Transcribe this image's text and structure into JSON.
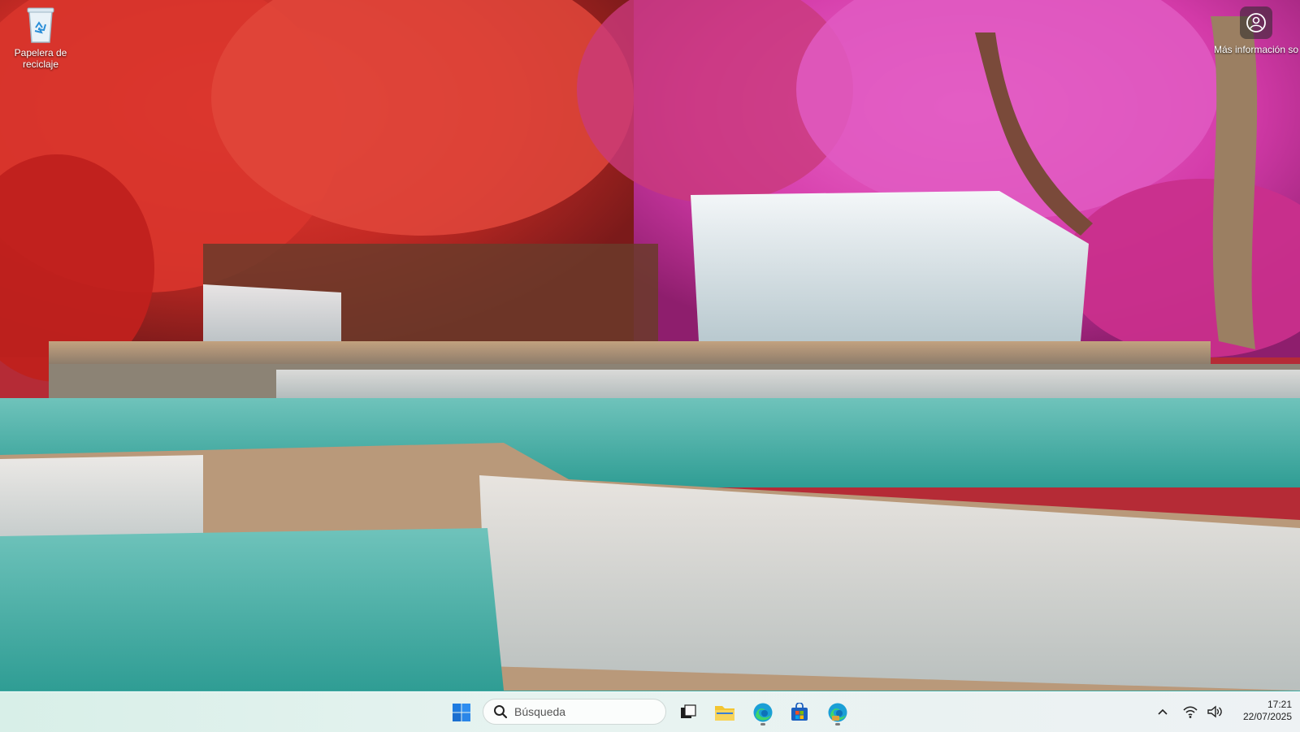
{
  "desktop": {
    "icons": [
      {
        "name": "recycle-bin",
        "label": "Papelera de reciclaje"
      },
      {
        "name": "more-info",
        "label": "Más información sobre esta imagen"
      }
    ]
  },
  "taskbar": {
    "search_placeholder": "Búsqueda",
    "pinned": [
      "Inicio",
      "Vista de tareas",
      "Explorador de archivos",
      "Microsoft Edge",
      "Microsoft Store",
      "Microsoft Edge Beta"
    ],
    "clock": {
      "time": "17:21",
      "date": "22/07/2025"
    }
  },
  "colors": {
    "taskbar_bg": "#e3f1ee",
    "start_blue": "#1e7be0",
    "folder_yellow": "#f3c531",
    "store_blue": "#1c5fbf"
  }
}
